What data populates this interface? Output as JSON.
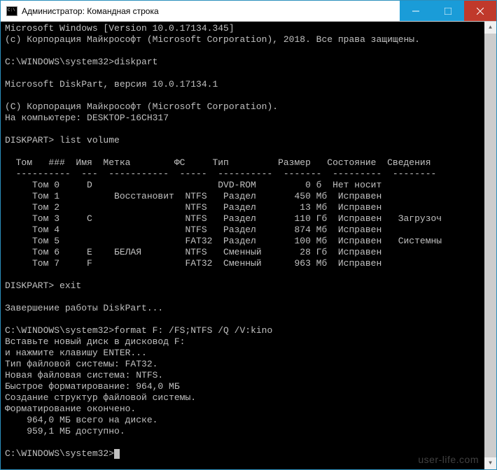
{
  "window": {
    "title": "Администратор: Командная строка"
  },
  "lines": {
    "l01": "Microsoft Windows [Version 10.0.17134.345]",
    "l02": "(c) Корпорация Майкрософт (Microsoft Corporation), 2018. Все права защищены.",
    "l03": "",
    "l04a": "C:\\WINDOWS\\system32>",
    "l04b": "diskpart",
    "l05": "",
    "l06": "Microsoft DiskPart, версия 10.0.17134.1",
    "l07": "",
    "l08": "(C) Корпорация Майкрософт (Microsoft Corporation).",
    "l09": "На компьютере: DESKTOP-16CH317",
    "l10": "",
    "l11a": "DISKPART> ",
    "l11b": "list volume",
    "l12": "",
    "hdr": "  Том   ###  Имя  Метка        ФС     Тип         Размер   Состояние  Сведения",
    "sep": "  ----------  ---  -----------  -----  ----------  -------  ---------  --------",
    "r0": "     Том 0     D                       DVD-ROM         0 б  Нет носит",
    "r1": "     Том 1          Восстановит  NTFS   Раздел       450 Мб  Исправен",
    "r2": "     Том 2                       NTFS   Раздел        13 Мб  Исправен",
    "r3": "     Том 3     C                 NTFS   Раздел       110 Гб  Исправен   Загрузоч",
    "r4": "     Том 4                       NTFS   Раздел       874 Мб  Исправен",
    "r5": "     Том 5                       FAT32  Раздел       100 Мб  Исправен   Системны",
    "r6": "     Том 6     E    БЕЛАЯ        NTFS   Сменный       28 Гб  Исправен",
    "r7": "     Том 7     F                 FAT32  Сменный      963 Мб  Исправен",
    "l20": "",
    "l21a": "DISKPART> ",
    "l21b": "exit",
    "l22": "",
    "l23": "Завершение работы DiskPart...",
    "l24": "",
    "l25a": "C:\\WINDOWS\\system32>",
    "l25b": "format F: /FS;NTFS /Q /V:kino",
    "l26": "Вставьте новый диск в дисковод F:",
    "l27": "и нажмите клавишу ENTER...",
    "l28": "Тип файловой системы: FAT32.",
    "l29": "Новая файловая система: NTFS.",
    "l30": "Быстрое форматирование: 964,0 МБ",
    "l31": "Создание структур файловой системы.",
    "l32": "Форматирование окончено.",
    "l33": "    964,0 МБ всего на диске.",
    "l34": "    959,1 МБ доступно.",
    "l35": "",
    "l36": "C:\\WINDOWS\\system32>"
  },
  "watermark": "user-life.com",
  "chart_data": {
    "type": "table",
    "title": "DISKPART list volume",
    "columns": [
      "Том",
      "###",
      "Имя",
      "Метка",
      "ФС",
      "Тип",
      "Размер",
      "Состояние",
      "Сведения"
    ],
    "rows": [
      [
        "Том 0",
        "",
        "D",
        "",
        "",
        "DVD-ROM",
        "0 б",
        "Нет носит",
        ""
      ],
      [
        "Том 1",
        "",
        "",
        "Восстановит",
        "NTFS",
        "Раздел",
        "450 Мб",
        "Исправен",
        ""
      ],
      [
        "Том 2",
        "",
        "",
        "",
        "NTFS",
        "Раздел",
        "13 Мб",
        "Исправен",
        ""
      ],
      [
        "Том 3",
        "",
        "C",
        "",
        "NTFS",
        "Раздел",
        "110 Гб",
        "Исправен",
        "Загрузоч"
      ],
      [
        "Том 4",
        "",
        "",
        "",
        "NTFS",
        "Раздел",
        "874 Мб",
        "Исправен",
        ""
      ],
      [
        "Том 5",
        "",
        "",
        "",
        "FAT32",
        "Раздел",
        "100 Мб",
        "Исправен",
        "Системны"
      ],
      [
        "Том 6",
        "",
        "E",
        "БЕЛАЯ",
        "NTFS",
        "Сменный",
        "28 Гб",
        "Исправен",
        ""
      ],
      [
        "Том 7",
        "",
        "F",
        "",
        "FAT32",
        "Сменный",
        "963 Мб",
        "Исправен",
        ""
      ]
    ]
  }
}
